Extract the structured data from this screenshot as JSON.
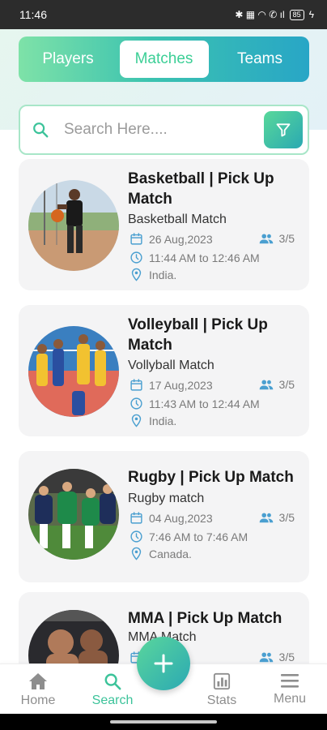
{
  "statusbar": {
    "time": "11:46",
    "icons_text": "✱ ▦ ◠ ✆ ıl",
    "battery": "85",
    "charging": "ϟ"
  },
  "tabs": [
    {
      "label": "Players",
      "active": false
    },
    {
      "label": "Matches",
      "active": true
    },
    {
      "label": "Teams",
      "active": false
    }
  ],
  "search": {
    "placeholder": "Search Here....",
    "value": ""
  },
  "matches": [
    {
      "title": "Basketball | Pick Up Match",
      "subtitle": "Basketball Match",
      "date": "26 Aug,2023",
      "players": "3/5",
      "time": "11:44 AM to 12:46 AM",
      "location": "India.",
      "image": "basketball-player-photo"
    },
    {
      "title": "Volleyball | Pick Up Match",
      "subtitle": "Vollyball Match",
      "date": "17 Aug,2023",
      "players": "3/5",
      "time": "11:43 AM to 12:44 AM",
      "location": "India.",
      "image": "volleyball-players-photo"
    },
    {
      "title": "Rugby | Pick Up Match",
      "subtitle": "Rugby match",
      "date": "04 Aug,2023",
      "players": "3/5",
      "time": "7:46 AM to 7:46 AM",
      "location": "Canada.",
      "image": "rugby-players-photo"
    },
    {
      "title": "MMA | Pick Up Match",
      "subtitle": "MMA Match",
      "date": "",
      "players": "3/5",
      "time": "",
      "location": "",
      "image": "mma-fighters-photo"
    }
  ],
  "bottom_nav": [
    {
      "label": "Home",
      "icon": "home-icon",
      "active": false
    },
    {
      "label": "Search",
      "icon": "search-icon",
      "active": true
    },
    {
      "label": "Stats",
      "icon": "stats-icon",
      "active": false
    },
    {
      "label": "Menu",
      "icon": "menu-icon",
      "active": false
    }
  ],
  "fab": {
    "icon": "plus-icon"
  },
  "colors": {
    "accent": "#3cc39a",
    "gradient_start": "#7ee2a8",
    "gradient_end": "#28a6c6",
    "meta_icon": "#4a9fd0"
  }
}
